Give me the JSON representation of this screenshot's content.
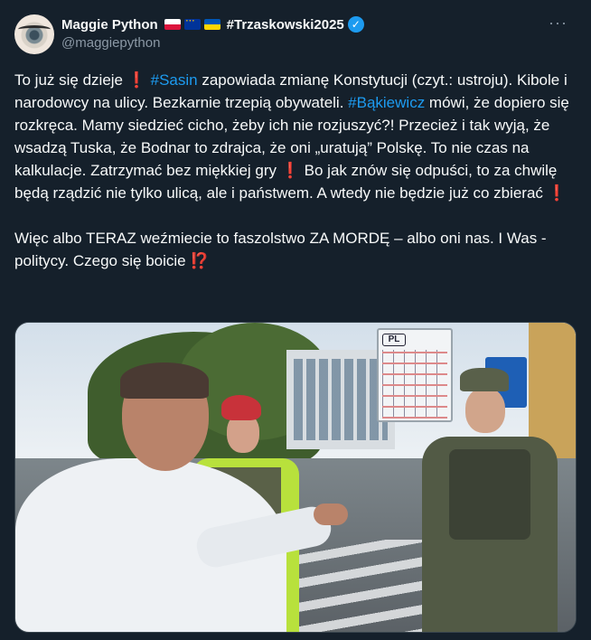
{
  "author": {
    "name": "Maggie Python",
    "flags": [
      "flag-pl",
      "flag-eu",
      "flag-ua"
    ],
    "name_hashtag": "#Trzaskowski2025",
    "handle": "@maggiepython",
    "verified": true,
    "verified_icon": "verified-badge-icon",
    "avatar_icon": "eye-avatar"
  },
  "more_label": "···",
  "body": {
    "p1_a": "To już się dzieje ",
    "mark1": "❗",
    "sp1": " ",
    "tag1": "#Sasin",
    "p1_b": " zapowiada zmianę Konstytucji (czyt.: ustroju). Kibole i narodowcy na ulicy. Bezkarnie trzepią obywateli. ",
    "tag2": "#Bąkiewicz",
    "p1_c": " mówi, że dopiero się rozkręca. Mamy siedzieć cicho, żeby ich nie rozjuszyć?! Przecież i tak wyją, że wsadzą Tuska, że Bodnar to zdrajca, że oni „uratują” Polskę. To nie czas na kalkulacje. Zatrzymać bez miękkiej gry ",
    "mark2": "❗",
    "p1_d": " Bo jak znów się odpuści, to za chwilę będą rządzić nie tylko ulicą, ale i państwem. A wtedy nie będzie już co zbierać ",
    "mark3": "❗",
    "p2": "\n\nWięc albo TERAZ weźmiecie to faszolstwo ZA MORDĘ – albo oni nas. I Was - politycy. Czego się boicie ",
    "mark4": "⁉️"
  },
  "media": {
    "sign_text": "PL"
  },
  "colors": {
    "background": "#15202b",
    "text": "#f7f9f9",
    "muted": "#8b98a5",
    "link": "#1d9bf0",
    "red_mark": "#f4212e"
  }
}
